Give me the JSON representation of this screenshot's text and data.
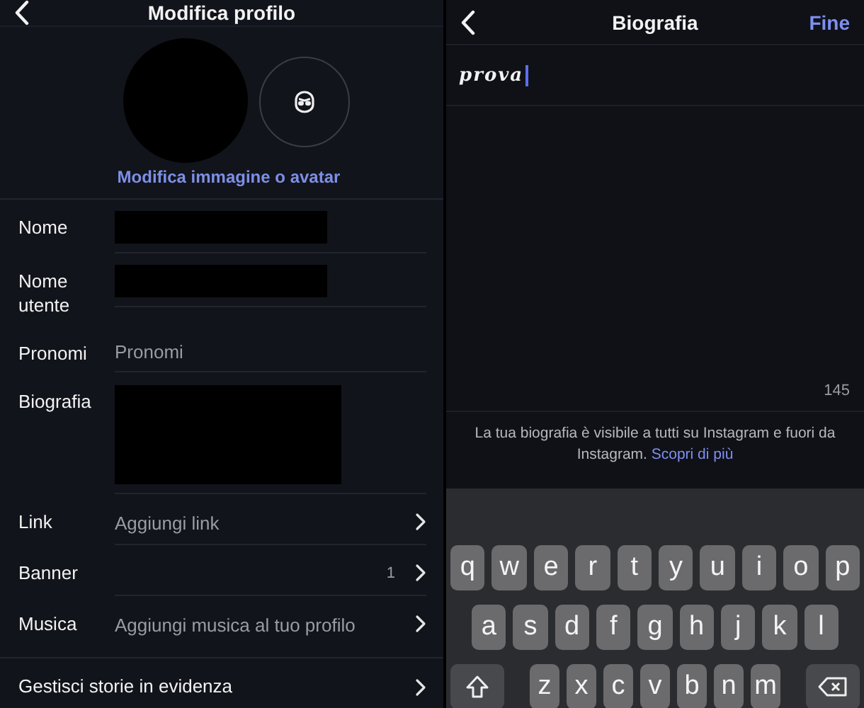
{
  "edit_profile": {
    "title": "Modifica profilo",
    "avatar_link": "Modifica immagine o avatar",
    "rows": [
      {
        "label": "Nome",
        "kind": "redacted"
      },
      {
        "label": "Nome utente",
        "kind": "redacted"
      },
      {
        "label": "Pronomi",
        "kind": "placeholder",
        "value": "Pronomi"
      },
      {
        "label": "Biografia",
        "kind": "redacted_tall"
      },
      {
        "label": "Link",
        "kind": "placeholder",
        "value": "Aggiungi link",
        "chevron": true
      },
      {
        "label": "Banner",
        "kind": "count",
        "value": "1",
        "chevron": true
      },
      {
        "label": "Musica",
        "kind": "placeholder",
        "value": "Aggiungi musica al tuo profilo",
        "chevron": true
      },
      {
        "label": "Gestisci storie in evidenza",
        "kind": "action",
        "chevron": true
      }
    ]
  },
  "bio_editor": {
    "title": "Biografia",
    "done": "Fine",
    "value": "prova",
    "counter": "145",
    "note": "La tua biografia è visibile a tutti su Instagram e fuori da Instagram.",
    "note_link": "Scopri di più"
  },
  "keyboard": {
    "rows": [
      [
        "q",
        "w",
        "e",
        "r",
        "t",
        "y",
        "u",
        "i",
        "o",
        "p"
      ],
      [
        "a",
        "s",
        "d",
        "f",
        "g",
        "h",
        "j",
        "k",
        "l"
      ],
      [
        "z",
        "x",
        "c",
        "v",
        "b",
        "n",
        "m"
      ]
    ]
  }
}
